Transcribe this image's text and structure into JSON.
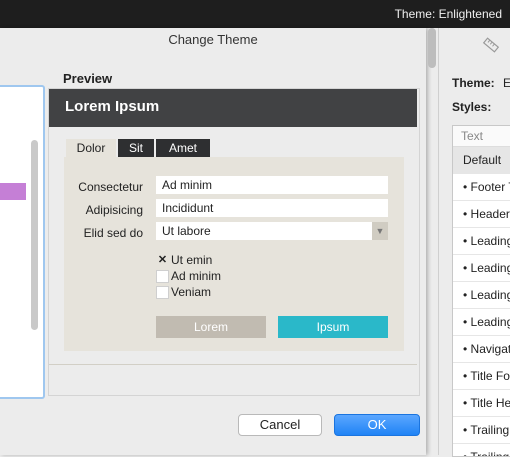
{
  "topbar": {
    "title": "Theme: Enlightened"
  },
  "inspector": {
    "ruler_icon": "ruler-icon",
    "theme_label": "Theme:",
    "theme_value": "E",
    "styles_label": "Styles:",
    "styles_header": "Text",
    "styles": [
      "Default",
      "• Footer T",
      "• Header",
      "• Leading",
      "• Leading",
      "• Leading",
      "• Leading",
      "• Navigat",
      "• Title Fo",
      "• Title He",
      "• Trailing",
      "• Trailing"
    ]
  },
  "dialog": {
    "title": "Change Theme",
    "preview_label": "Preview",
    "preview": {
      "heading": "Lorem Ipsum",
      "tabs": [
        "Dolor",
        "Sit",
        "Amet"
      ],
      "fields": [
        {
          "label": "Consectetur",
          "value": "Ad minim"
        },
        {
          "label": "Adipisicing",
          "value": "Incididunt"
        },
        {
          "label": "Elid sed do",
          "value": "Ut labore"
        }
      ],
      "checkboxes": [
        {
          "label": "Ut emin",
          "checked_mark": "✕"
        },
        {
          "label": "Ad minim",
          "checked_mark": ""
        },
        {
          "label": "Veniam",
          "checked_mark": ""
        }
      ],
      "button_secondary": "Lorem",
      "button_primary": "Ipsum",
      "colors": {
        "header": "#414244",
        "panel": "#e6e3db",
        "primary": "#2ab8c9",
        "secondary": "#c1bbb1"
      }
    },
    "cancel_label": "Cancel",
    "ok_label": "OK"
  }
}
